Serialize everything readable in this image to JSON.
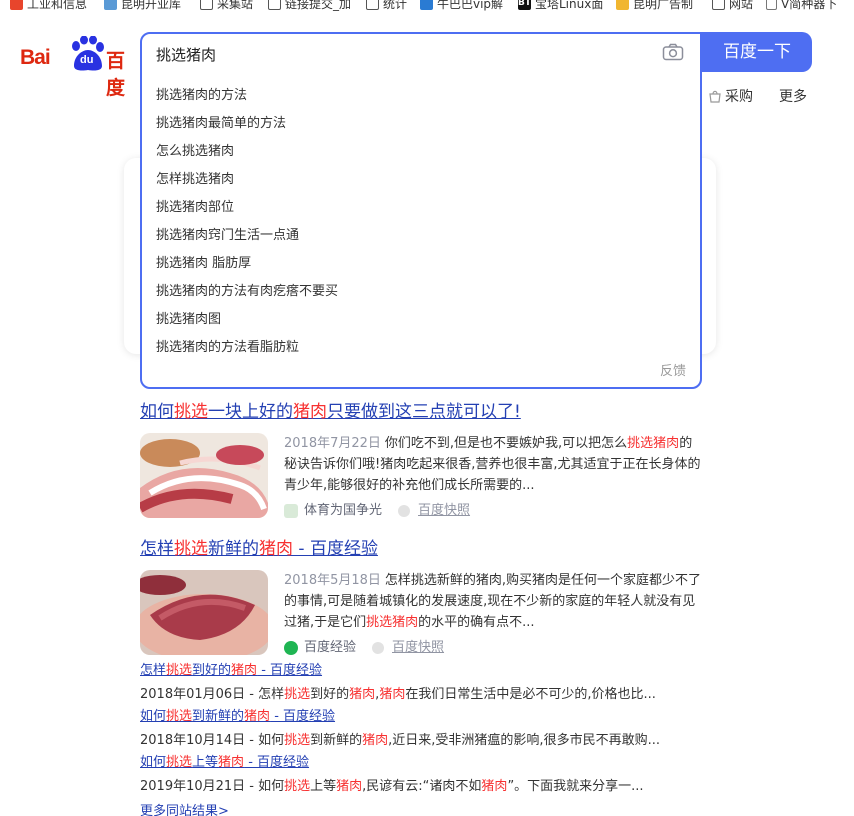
{
  "bookmarks": [
    {
      "label": "工业和信息",
      "icon": "weibo-icon"
    },
    {
      "label": "昆明开业库",
      "icon": "weather-icon"
    },
    {
      "label": "采集站",
      "icon": "folder-icon"
    },
    {
      "label": "链接提交_加",
      "icon": "folder-icon"
    },
    {
      "label": "统计",
      "icon": "folder-icon"
    },
    {
      "label": "牛巴巴vip解",
      "icon": "globe-icon"
    },
    {
      "label": "宝塔Linux面",
      "icon": "bt-icon"
    },
    {
      "label": "昆明广告制",
      "icon": "bulb-icon"
    },
    {
      "label": "网站",
      "icon": "folder-icon"
    },
    {
      "label": "V简种器下",
      "icon": "doc-icon"
    }
  ],
  "logo": {
    "latin": "Bai",
    "paw": "du",
    "cn": "百度"
  },
  "search": {
    "query": "挑选猪肉",
    "button_label": "百度一下",
    "feedback_label": "反馈",
    "suggestions": [
      {
        "hl": "挑选猪肉",
        "rest": "的方法"
      },
      {
        "hl": "挑选猪肉",
        "rest": "最简单的方法"
      },
      {
        "hl": "",
        "rest": "怎么挑选猪肉"
      },
      {
        "hl": "",
        "rest": "怎样挑选猪肉"
      },
      {
        "hl": "挑选猪肉",
        "rest": "部位"
      },
      {
        "hl": "挑选猪肉",
        "rest": "窍门生活一点通"
      },
      {
        "hl": "挑选猪肉",
        "rest": " 脂肪厚"
      },
      {
        "hl": "挑选猪肉",
        "rest": "的方法有肉疙瘩不要买"
      },
      {
        "hl": "挑选猪肉",
        "rest": "图"
      },
      {
        "hl": "挑选猪肉",
        "rest": "的方法看脂肪粒"
      }
    ]
  },
  "tabs_right": {
    "caigou": "采购",
    "more": "更多"
  },
  "results": [
    {
      "title_parts": [
        "如何",
        "挑选",
        "一块上好的",
        "猪肉",
        "只要做到这三点就可以了!"
      ],
      "date": "2018年7月22日",
      "desc_parts": [
        "你们吃不到,但是也不要嫉妒我,可以把怎么",
        "挑选猪肉",
        "的秘诀告诉你们哦!猪肉吃起来很香,营养也很丰富,尤其适宜于正在长身体的青少年,能够很好的补充他们成长所需要的..."
      ],
      "source": "体育为国争光",
      "snapshot": "百度快照"
    },
    {
      "title_parts": [
        "怎样",
        "挑选",
        "新鲜的",
        "猪肉",
        " - 百度经验"
      ],
      "date": "2018年5月18日",
      "desc_parts": [
        "怎样挑选新鲜的猪肉,购买猪肉是任何一个家庭都少不了的事情,可是随着城镇化的发展速度,现在不少新的家庭的年轻人就没有见过猪,于是它们",
        "挑选猪肉",
        "的水平的确有点不..."
      ],
      "source": "百度经验",
      "snapshot": "百度快照"
    }
  ],
  "sub_results": [
    {
      "title_parts": [
        "怎样",
        "挑选",
        "到好的",
        "猪肉",
        " - 百度经验"
      ],
      "desc_parts": [
        "2018年01月06日 - 怎样",
        "挑选",
        "到好的",
        "猪肉",
        ",",
        "猪肉",
        "在我们日常生活中是必不可少的,价格也比..."
      ]
    },
    {
      "title_parts": [
        "如何",
        "挑选",
        "到新鲜的",
        "猪肉",
        " - 百度经验"
      ],
      "desc_parts": [
        "2018年10月14日 - 如何",
        "挑选",
        "到新鲜的",
        "猪肉",
        ",近日来,受非洲猪瘟的影响,很多市民不再敢购..."
      ]
    },
    {
      "title_parts": [
        "如何",
        "挑选",
        "上等",
        "猪肉",
        " - 百度经验"
      ],
      "desc_parts": [
        "2019年10月21日 - 如何",
        "挑选",
        "上等",
        "猪肉",
        ",民谚有云:“诸肉不如",
        "猪肉",
        "”。下面我就来分享一..."
      ]
    }
  ],
  "more_results": "更多同站结果>",
  "colors": {
    "accent": "#4e6ef2",
    "link": "#2440b3",
    "highlight": "#f73131",
    "logo_red": "#de2810"
  }
}
